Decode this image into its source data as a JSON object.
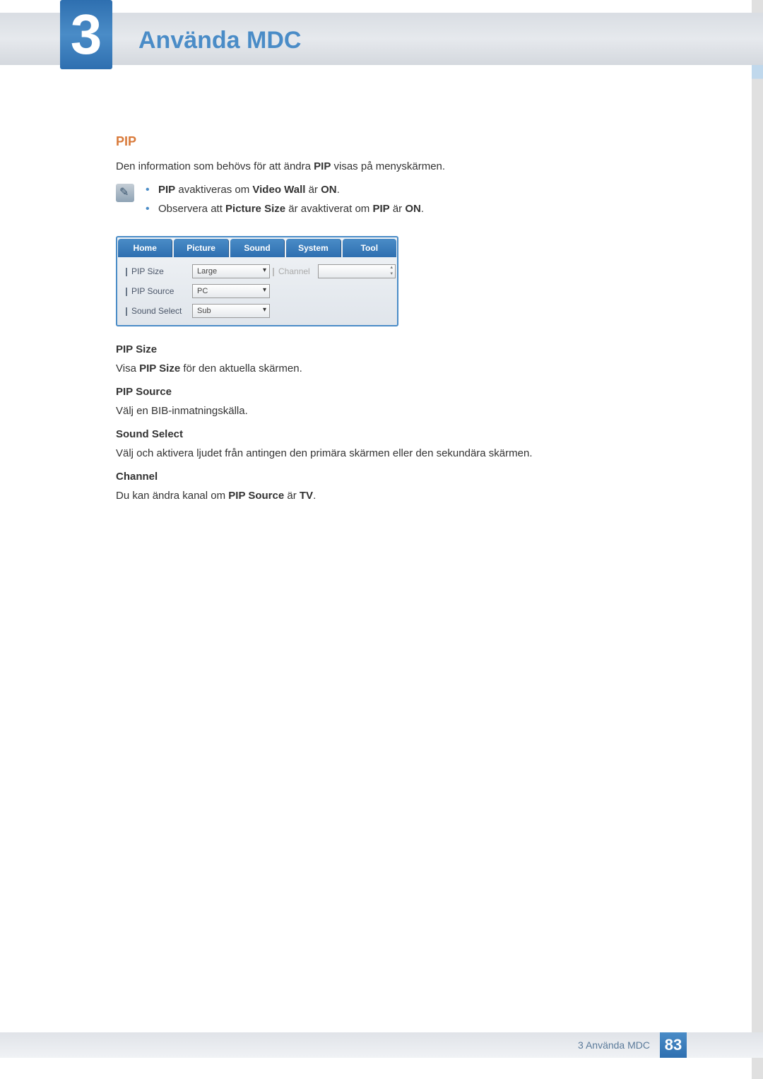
{
  "chapter": {
    "number": "3",
    "title": "Använda MDC"
  },
  "section": {
    "heading": "PIP"
  },
  "intro": {
    "prefix": "Den information som behövs för att ändra ",
    "bold1": "PIP",
    "suffix": " visas på menyskärmen."
  },
  "notes": {
    "n1": {
      "b1": "PIP",
      "t1": " avaktiveras om ",
      "b2": "Video Wall",
      "t2": " är ",
      "b3": "ON",
      "t3": "."
    },
    "n2": {
      "t1": "Observera att ",
      "b1": "Picture Size",
      "t2": " är avaktiverat om ",
      "b2": "PIP",
      "t3": " är ",
      "b3": "ON",
      "t4": "."
    }
  },
  "tabs": {
    "home": "Home",
    "picture": "Picture",
    "sound": "Sound",
    "system": "System",
    "tool": "Tool"
  },
  "fields": {
    "pip_size": {
      "label": "PIP Size",
      "value": "Large"
    },
    "channel": {
      "label": "Channel"
    },
    "pip_source": {
      "label": "PIP Source",
      "value": "PC"
    },
    "sound_select": {
      "label": "Sound Select",
      "value": "Sub"
    }
  },
  "subs": {
    "pip_size": {
      "h": "PIP Size",
      "p_pre": "Visa ",
      "p_b": "PIP Size",
      "p_post": " för den aktuella skärmen."
    },
    "pip_source": {
      "h": "PIP Source",
      "p": "Välj en BIB-inmatningskälla."
    },
    "sound_select": {
      "h": "Sound Select",
      "p": "Välj och aktivera ljudet från antingen den primära skärmen eller den sekundära skärmen."
    },
    "channel": {
      "h": "Channel",
      "p_pre": "Du kan ändra kanal om ",
      "p_b1": "PIP Source",
      "p_mid": " är ",
      "p_b2": "TV",
      "p_post": "."
    }
  },
  "footer": {
    "text": "3 Använda MDC",
    "page": "83"
  }
}
